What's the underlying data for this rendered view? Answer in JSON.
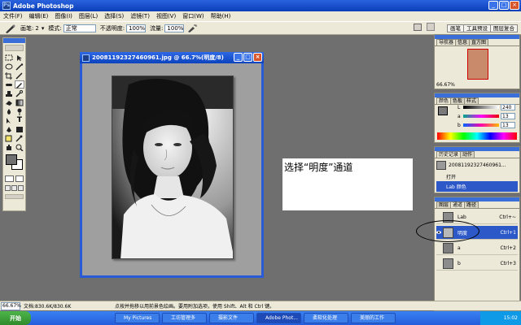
{
  "app": {
    "title": "Adobe Photoshop"
  },
  "menu": [
    "文件(F)",
    "编辑(E)",
    "图像(I)",
    "图层(L)",
    "选择(S)",
    "滤镜(T)",
    "视图(V)",
    "窗口(W)",
    "帮助(H)"
  ],
  "options": {
    "brush_label": "画笔:",
    "brush_size": "2",
    "mode_label": "模式:",
    "mode_value": "正常",
    "opacity_label": "不透明度:",
    "opacity_value": "100%",
    "flow_label": "流量:",
    "flow_value": "100%"
  },
  "palette_well": [
    "画笔",
    "工具预设",
    "图层复合"
  ],
  "document": {
    "title": "20081192327460961.jpg @ 66.7%(明度/8)"
  },
  "caption": "选择“明度”通道",
  "navigator": {
    "tabs": [
      "导航器",
      "信息",
      "直方图"
    ],
    "zoom": "66.67%"
  },
  "color_panel": {
    "tabs": [
      "颜色",
      "色板",
      "样式"
    ],
    "channels": [
      {
        "label": "L",
        "value": "240"
      },
      {
        "label": "a",
        "value": "13"
      },
      {
        "label": "b",
        "value": "13"
      }
    ]
  },
  "history": {
    "tabs": [
      "历史记录",
      "动作"
    ],
    "snapshot": "20081192327460961...",
    "items": [
      "打开",
      "Lab 颜色"
    ]
  },
  "channels": {
    "tabs": [
      "图层",
      "通道",
      "路径"
    ],
    "rows": [
      {
        "name": "Lab",
        "shortcut": "Ctrl+~"
      },
      {
        "name": "明度",
        "shortcut": "Ctrl+1"
      },
      {
        "name": "a",
        "shortcut": "Ctrl+2"
      },
      {
        "name": "b",
        "shortcut": "Ctrl+3"
      }
    ]
  },
  "status": {
    "zoom": "66.67%",
    "doc": "文档:830.6K/830.6K",
    "hint": "点按并拖移以用前景色绘画。要用附加选项，使用 Shift、Alt 和 Ctrl 键。"
  },
  "taskbar": {
    "start": "开始",
    "tasks": [
      "My Pictures",
      "工坊管理多",
      "摄影文件",
      "Adobe Phot...",
      "柔软化处理",
      "美丽的工作"
    ],
    "time": "15:02"
  }
}
